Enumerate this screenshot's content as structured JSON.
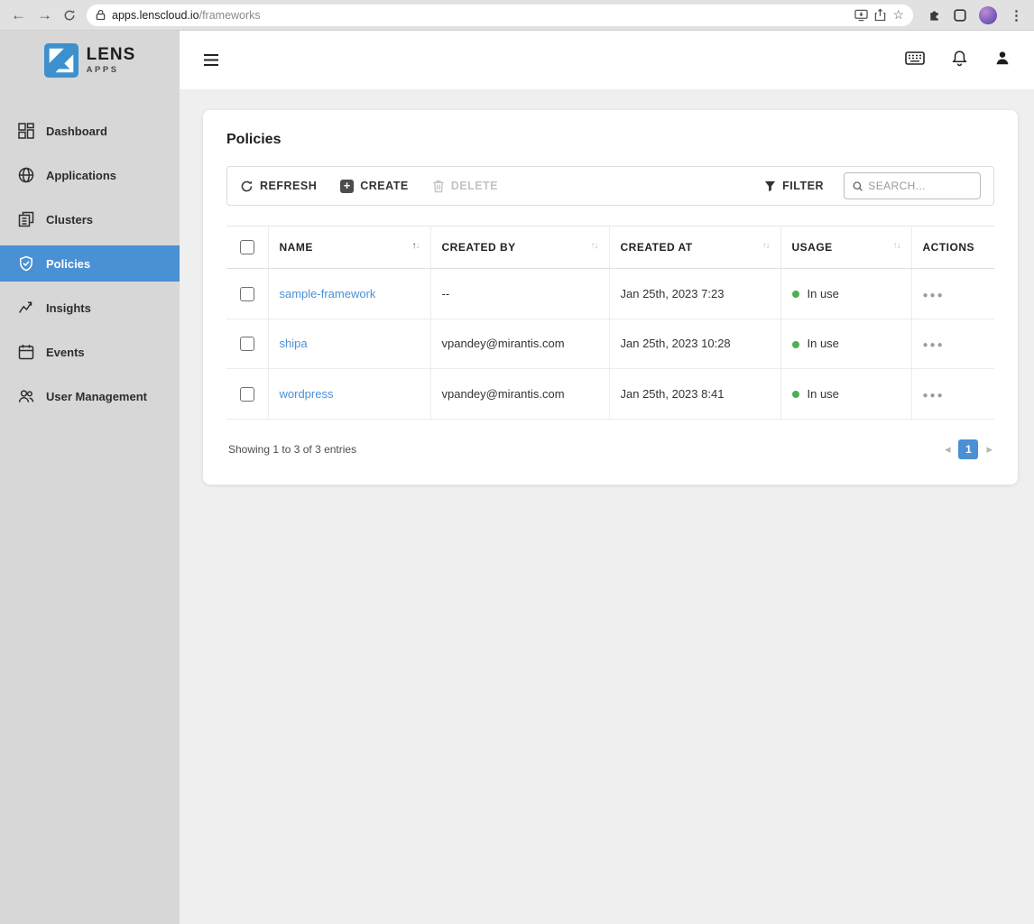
{
  "browser": {
    "url_host": "apps.lenscloud.io",
    "url_path": "/frameworks"
  },
  "brand": {
    "name": "LENS",
    "sub": "APPS"
  },
  "sidebar": {
    "items": [
      {
        "label": "Dashboard",
        "active": false
      },
      {
        "label": "Applications",
        "active": false
      },
      {
        "label": "Clusters",
        "active": false
      },
      {
        "label": "Policies",
        "active": true
      },
      {
        "label": "Insights",
        "active": false
      },
      {
        "label": "Events",
        "active": false
      },
      {
        "label": "User Management",
        "active": false
      }
    ]
  },
  "main": {
    "title": "Policies",
    "toolbar": {
      "refresh": "REFRESH",
      "create": "CREATE",
      "delete": "DELETE",
      "filter": "FILTER",
      "search_placeholder": "SEARCH..."
    },
    "table": {
      "headers": {
        "name": "NAME",
        "created_by": "CREATED BY",
        "created_at": "CREATED AT",
        "usage": "USAGE",
        "actions": "ACTIONS"
      },
      "rows": [
        {
          "name": "sample-framework",
          "created_by": "--",
          "created_at": "Jan 25th, 2023 7:23",
          "usage": "In use"
        },
        {
          "name": "shipa",
          "created_by": "vpandey@mirantis.com",
          "created_at": "Jan 25th, 2023 10:28",
          "usage": "In use"
        },
        {
          "name": "wordpress",
          "created_by": "vpandey@mirantis.com",
          "created_at": "Jan 25th, 2023 8:41",
          "usage": "In use"
        }
      ]
    },
    "footer": {
      "showing": "Showing 1 to 3 of 3 entries",
      "page": "1"
    }
  },
  "colors": {
    "accent_blue": "#4a90d5",
    "link_blue": "#4a90d9",
    "in_use_green": "#4caf50",
    "sidebar_gray": "#d7d7d7"
  }
}
